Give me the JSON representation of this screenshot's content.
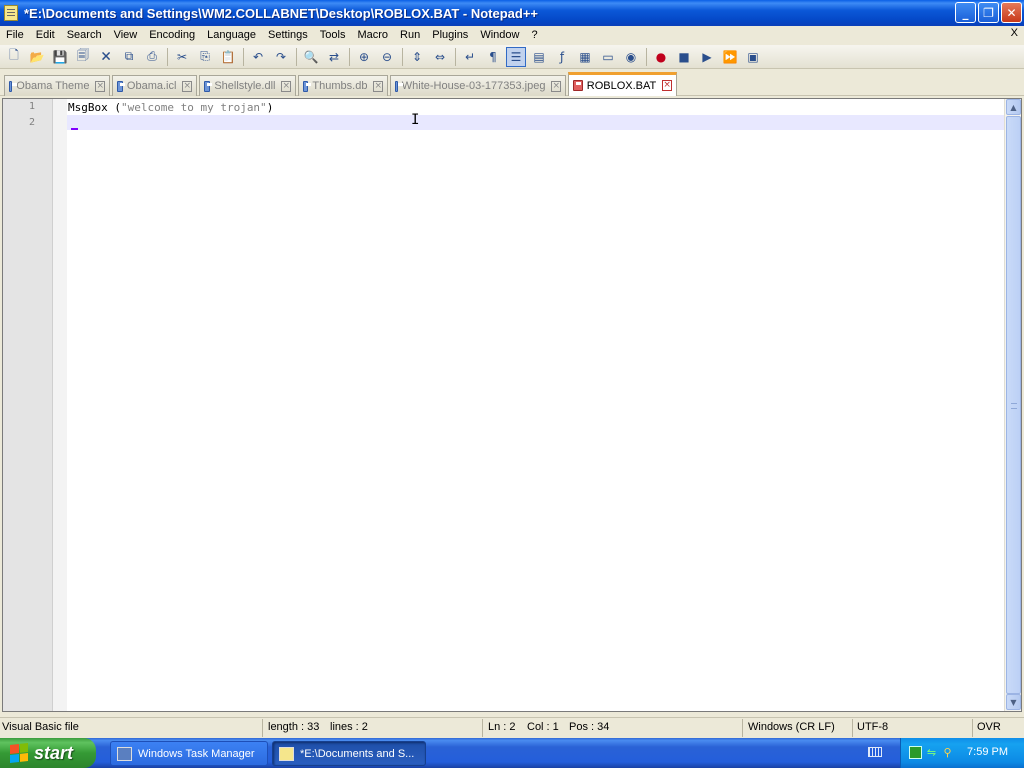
{
  "window": {
    "title": "*E:\\Documents and Settings\\WM2.COLLABNET\\Desktop\\ROBLOX.BAT - Notepad++",
    "buttons": {
      "minimize": "_",
      "maximize": "❐",
      "close": "✕"
    }
  },
  "menu": {
    "items": [
      "File",
      "Edit",
      "Search",
      "View",
      "Encoding",
      "Language",
      "Settings",
      "Tools",
      "Macro",
      "Run",
      "Plugins",
      "Window",
      "?"
    ],
    "close_label": "X"
  },
  "toolbar": {
    "icons": [
      "new-file-icon",
      "open-file-icon",
      "save-icon",
      "save-all-icon",
      "close-icon",
      "close-all-icon",
      "print-icon",
      "cut-icon",
      "copy-icon",
      "paste-icon",
      "undo-icon",
      "redo-icon",
      "find-icon",
      "replace-icon",
      "zoom-in-icon",
      "zoom-out-icon",
      "sync-vertical-icon",
      "sync-horizontal-icon",
      "word-wrap-icon",
      "show-all-chars-icon",
      "indent-guide-icon",
      "user-language-icon",
      "function-list-icon",
      "doc-map-icon",
      "folder-workspace-icon",
      "monitor-icon",
      "record-macro-icon",
      "stop-macro-icon",
      "play-macro-icon",
      "run-macro-multiple-icon",
      "save-macro-icon"
    ]
  },
  "tabs": [
    {
      "label": "Obama Theme",
      "active": false
    },
    {
      "label": "Obama.icl",
      "active": false
    },
    {
      "label": "Shellstyle.dll",
      "active": false
    },
    {
      "label": "Thumbs.db",
      "active": false
    },
    {
      "label": "White-House-03-177353.jpeg",
      "active": false
    },
    {
      "label": "ROBLOX.BAT",
      "active": true
    }
  ],
  "editor": {
    "lines": [
      {
        "number": "1",
        "keyword": "MsgBox (",
        "string": "\"welcome to my trojan\"",
        "tail": ")"
      },
      {
        "number": "2",
        "keyword": "",
        "string": "",
        "tail": ""
      }
    ],
    "current_line": 2
  },
  "status": {
    "language": "Visual Basic file",
    "length": "length : 33",
    "lines": "lines : 2",
    "ln": "Ln : 2",
    "col": "Col : 1",
    "pos": "Pos : 34",
    "eol": "Windows (CR LF)",
    "encoding": "UTF-8",
    "mode": "OVR"
  },
  "taskbar": {
    "start_label": "start",
    "tasks": [
      {
        "label": "Windows Task Manager",
        "active": false
      },
      {
        "label": "*E:\\Documents and S...",
        "active": true
      }
    ],
    "clock": "7:59 PM"
  },
  "colors": {
    "title_bar": "#0447c6",
    "current_line_bg": "#e8e8ff",
    "active_tab_accent": "#f0a030",
    "caret": "#8000ff",
    "string_text": "#808080",
    "start_button": "#359a35",
    "taskbar": "#245edb"
  }
}
